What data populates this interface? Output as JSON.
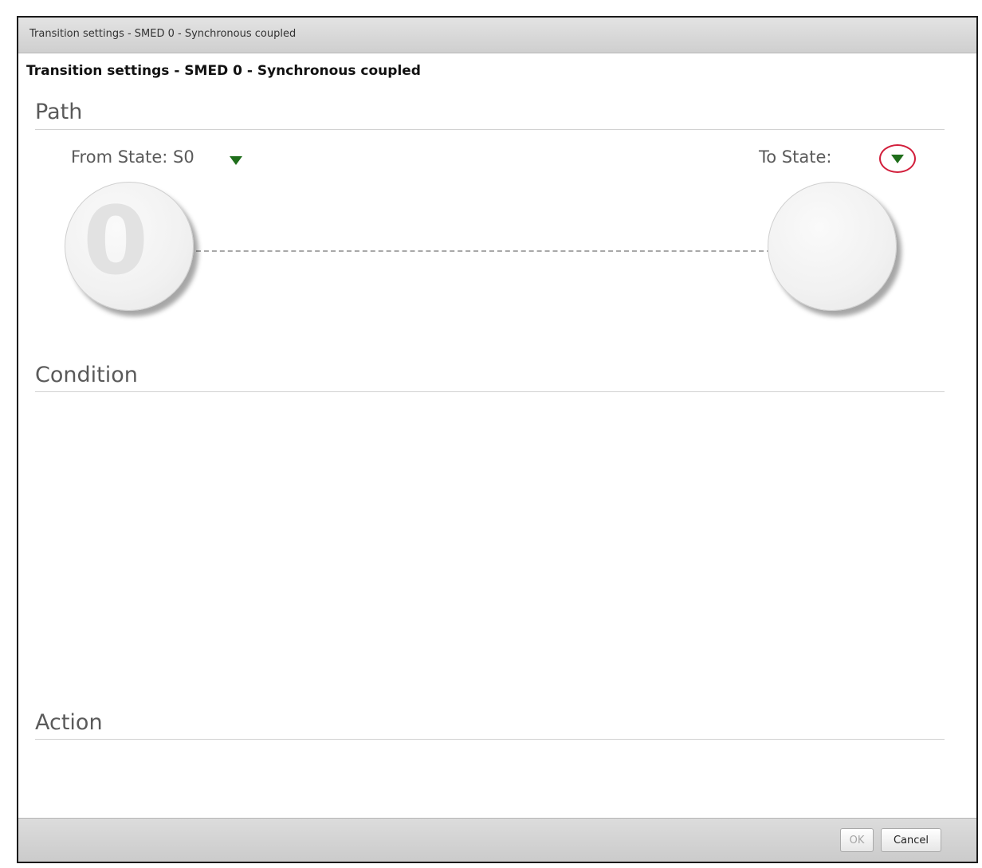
{
  "window": {
    "title": "Transition settings - SMED 0 - Synchronous coupled"
  },
  "dialog": {
    "heading": "Transition settings - SMED 0 - Synchronous coupled"
  },
  "path": {
    "section_title": "Path",
    "from_state_label": "From State: S0",
    "to_state_label": "To State:",
    "from_node_glyph": "0",
    "dropdown_icon": "triangle-down-icon"
  },
  "condition": {
    "section_title": "Condition"
  },
  "action": {
    "section_title": "Action"
  },
  "footer": {
    "ok_label": "OK",
    "cancel_label": "Cancel"
  },
  "colors": {
    "accent_green": "#1f6e1b",
    "highlight_red": "#d21f3c"
  }
}
